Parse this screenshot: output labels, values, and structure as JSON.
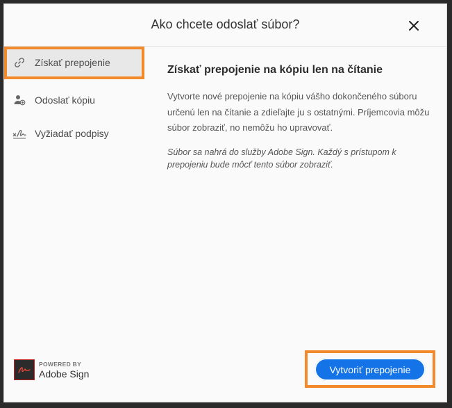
{
  "dialog": {
    "title": "Ako chcete odoslať súbor?"
  },
  "sidebar": {
    "items": [
      {
        "label": "Získať prepojenie",
        "icon": "link-icon",
        "active": true
      },
      {
        "label": "Odoslať kópiu",
        "icon": "add-person-icon",
        "active": false
      },
      {
        "label": "Vyžiadať podpisy",
        "icon": "signature-icon",
        "active": false
      }
    ]
  },
  "content": {
    "title": "Získať prepojenie na kópiu len na čítanie",
    "description": "Vytvorte nové prepojenie na kópiu vášho dokončeného súboru určenú len na čítanie a zdieľajte ju s ostatnými. Príjemcovia môžu súbor zobraziť, no nemôžu ho upravovať.",
    "note": "Súbor sa nahrá do služby Adobe Sign. Každý s prístupom k prepojeniu bude môcť tento súbor zobraziť."
  },
  "brand": {
    "powered_by": "POWERED BY",
    "name": "Adobe Sign"
  },
  "actions": {
    "primary_label": "Vytvoriť prepojenie"
  },
  "colors": {
    "accent": "#1473e6",
    "highlight": "#f28a2b",
    "brand_red": "#c21f1f"
  }
}
